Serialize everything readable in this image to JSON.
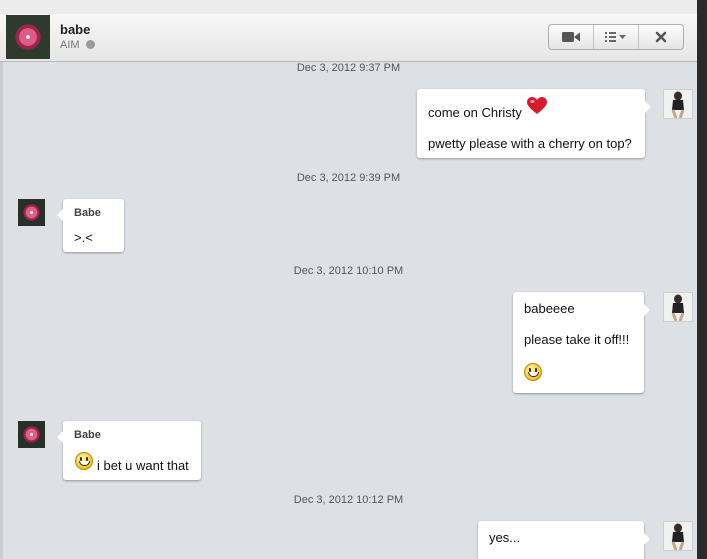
{
  "header": {
    "contact_name": "babe",
    "service": "AIM",
    "buttons": [
      {
        "icon": "video-camera-icon"
      },
      {
        "icon": "list-menu-icon"
      },
      {
        "icon": "close-icon"
      }
    ]
  },
  "conversation": {
    "timestamps": [
      "Dec 3, 2012 9:37 PM",
      "Dec 3, 2012 9:39 PM",
      "Dec 3, 2012 10:10 PM",
      "Dec 3, 2012 10:12 PM"
    ],
    "messages": [
      {
        "from": "me",
        "lines": [
          "come on Christy",
          "pwetty please with a cherry on top?"
        ],
        "emoji": "heart-icon"
      },
      {
        "from": "other",
        "sender": "Babe",
        "lines": [
          ">.<"
        ]
      },
      {
        "from": "me",
        "lines": [
          "babeeee",
          "please take it off!!!"
        ],
        "emoji": "smiley-icon"
      },
      {
        "from": "other",
        "sender": "Babe",
        "lines": [
          "i bet u want that"
        ],
        "emoji": "smiley-icon"
      },
      {
        "from": "me",
        "lines": [
          "yes..."
        ]
      }
    ]
  },
  "colors": {
    "chat_background": "#dde1e6",
    "bubble": "#ffffff",
    "heart": "#d81b2c"
  }
}
